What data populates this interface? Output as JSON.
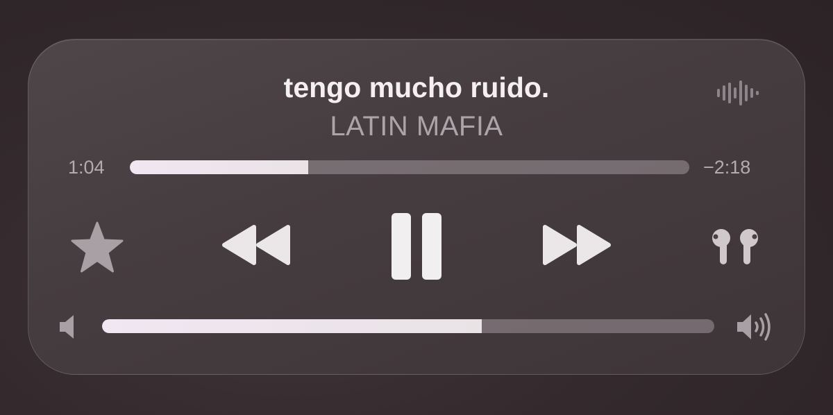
{
  "now_playing": {
    "title": "tengo mucho ruido.",
    "artist": "LATIN MAFIA"
  },
  "playback": {
    "elapsed": "1:04",
    "remaining": "−2:18",
    "progress_fraction": 0.319
  },
  "volume": {
    "level_fraction": 0.62
  },
  "icons": {
    "waveform": "waveform-icon",
    "favorite": "star-icon",
    "rewind": "rewind-icon",
    "pause": "pause-icon",
    "forward": "fast-forward-icon",
    "output_device": "airpods-icon",
    "volume_low": "speaker-low-icon",
    "volume_high": "speaker-high-icon"
  },
  "colors": {
    "panel": "#4a4144",
    "text_primary": "#f4eff1",
    "text_secondary": "#aca4a8",
    "fill": "#ece6ea",
    "track": "#7a7174",
    "icon": "#ebe7e9",
    "icon_dim": "#a59da0"
  }
}
